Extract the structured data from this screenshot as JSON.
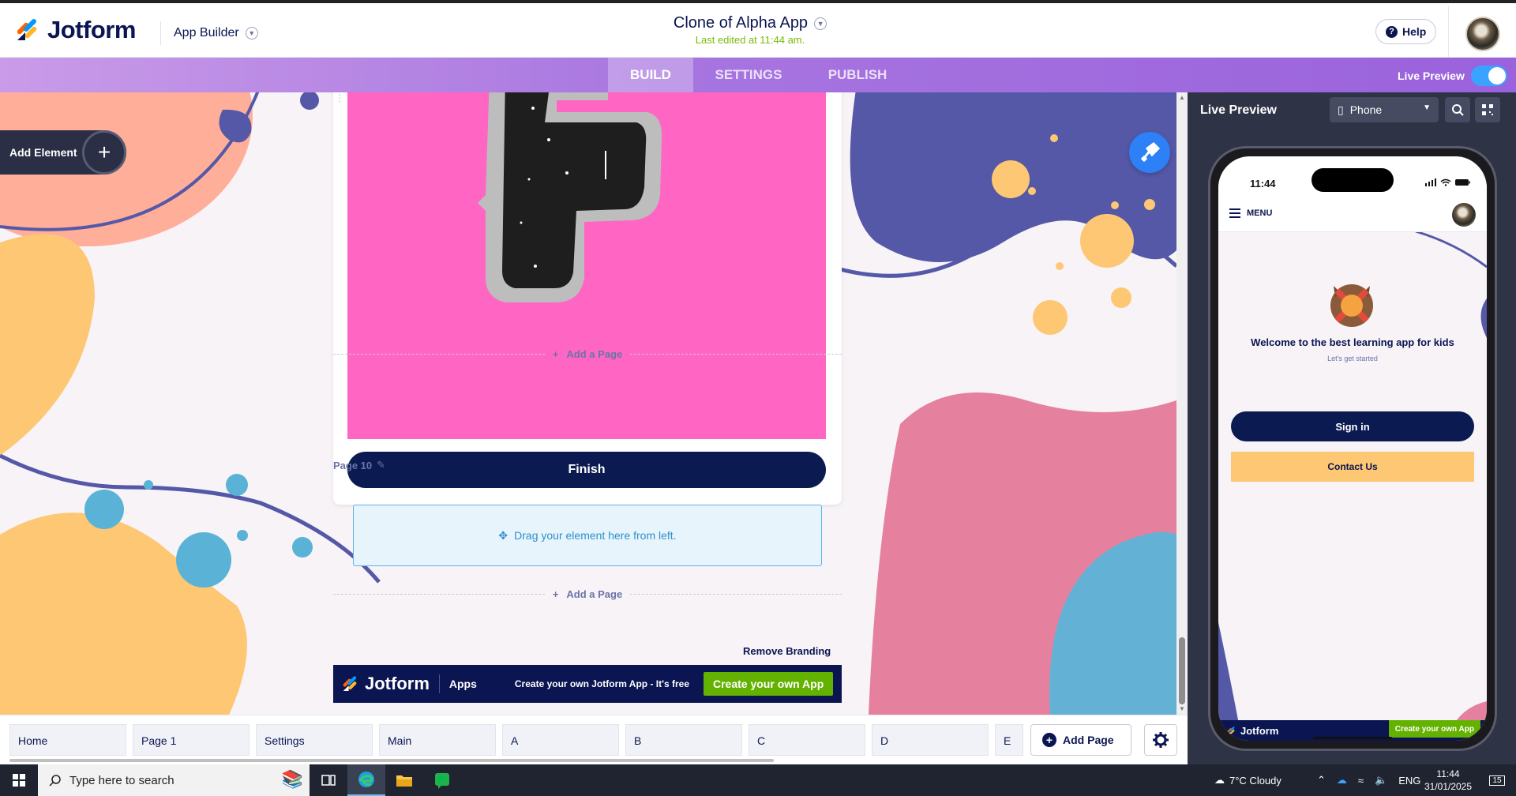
{
  "header": {
    "logo_text": "Jotform",
    "app_builder_label": "App Builder",
    "app_title": "Clone of Alpha App",
    "last_edited": "Last edited at 11:44 am.",
    "help_label": "Help"
  },
  "nav": {
    "tabs": [
      {
        "label": "BUILD",
        "active": true
      },
      {
        "label": "SETTINGS",
        "active": false
      },
      {
        "label": "PUBLISH",
        "active": false
      }
    ],
    "live_preview_label": "Live Preview",
    "live_preview_on": true
  },
  "canvas": {
    "add_element_label": "Add Element",
    "finish_label": "Finish",
    "add_page_label": "Add a Page",
    "page_label": "Page 10",
    "dropzone_text": "Drag your element here from left.",
    "remove_branding": "Remove Branding",
    "branding": {
      "logo": "Jotform",
      "apps": "Apps",
      "text": "Create your own Jotform App - It's free",
      "button": "Create your own App"
    }
  },
  "page_tabs": {
    "tabs": [
      "Home",
      "Page 1",
      "Settings",
      "Main",
      "A",
      "B",
      "C",
      "D",
      "E"
    ],
    "add_page_label": "Add Page"
  },
  "live_preview": {
    "title": "Live Preview",
    "device": "Phone",
    "phone": {
      "time": "11:44",
      "menu_label": "MENU",
      "welcome": "Welcome to the best learning app for kids",
      "subtitle": "Let's get started",
      "sign_in": "Sign in",
      "contact": "Contact Us",
      "footer_logo": "Jotform",
      "footer_button": "Create your own App"
    }
  },
  "taskbar": {
    "search_placeholder": "Type here to search",
    "weather": "7°C  Cloudy",
    "language": "ENG",
    "time": "11:44",
    "date": "31/01/2025",
    "notifications": "15"
  },
  "colors": {
    "brand_navy": "#0a1551",
    "nav_purple": "#a775e0",
    "accent_green": "#64b200",
    "canvas_bg": "#f7f3f7"
  }
}
